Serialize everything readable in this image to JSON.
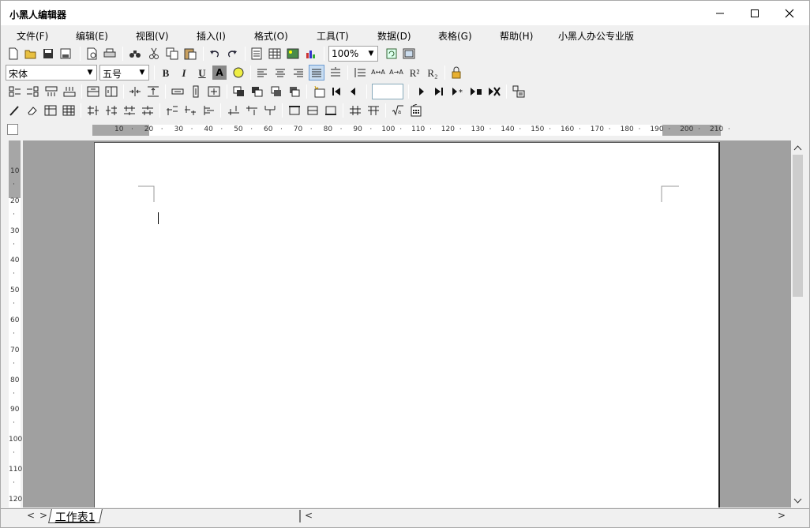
{
  "window": {
    "title": "小黑人编辑器"
  },
  "menu": [
    "文件(F)",
    "编辑(E)",
    "视图(V)",
    "插入(I)",
    "格式(O)",
    "工具(T)",
    "数据(D)",
    "表格(G)",
    "帮助(H)",
    "小黑人办公专业版"
  ],
  "toolbar": {
    "zoom": "100%",
    "font_name": "宋体",
    "font_size": "五号",
    "bold": "B",
    "italic": "I",
    "underline": "U",
    "shade": "A",
    "superscript": "R²",
    "subscript": "R₂",
    "record_value": ""
  },
  "ruler": {
    "h_labels": [
      "10",
      "20",
      "30",
      "40",
      "50",
      "60",
      "70",
      "80",
      "90",
      "100",
      "110",
      "120",
      "130",
      "140",
      "150",
      "160",
      "170",
      "180",
      "190",
      "200",
      "210"
    ],
    "v_labels": [
      "10",
      "20",
      "30",
      "40",
      "50",
      "60",
      "70",
      "80",
      "90",
      "100",
      "110",
      "120"
    ]
  },
  "sheet": {
    "tab": "工作表1"
  },
  "nav": {
    "prev": "<",
    "next": ">"
  },
  "hscroll": {
    "left": "<",
    "right": ">"
  }
}
